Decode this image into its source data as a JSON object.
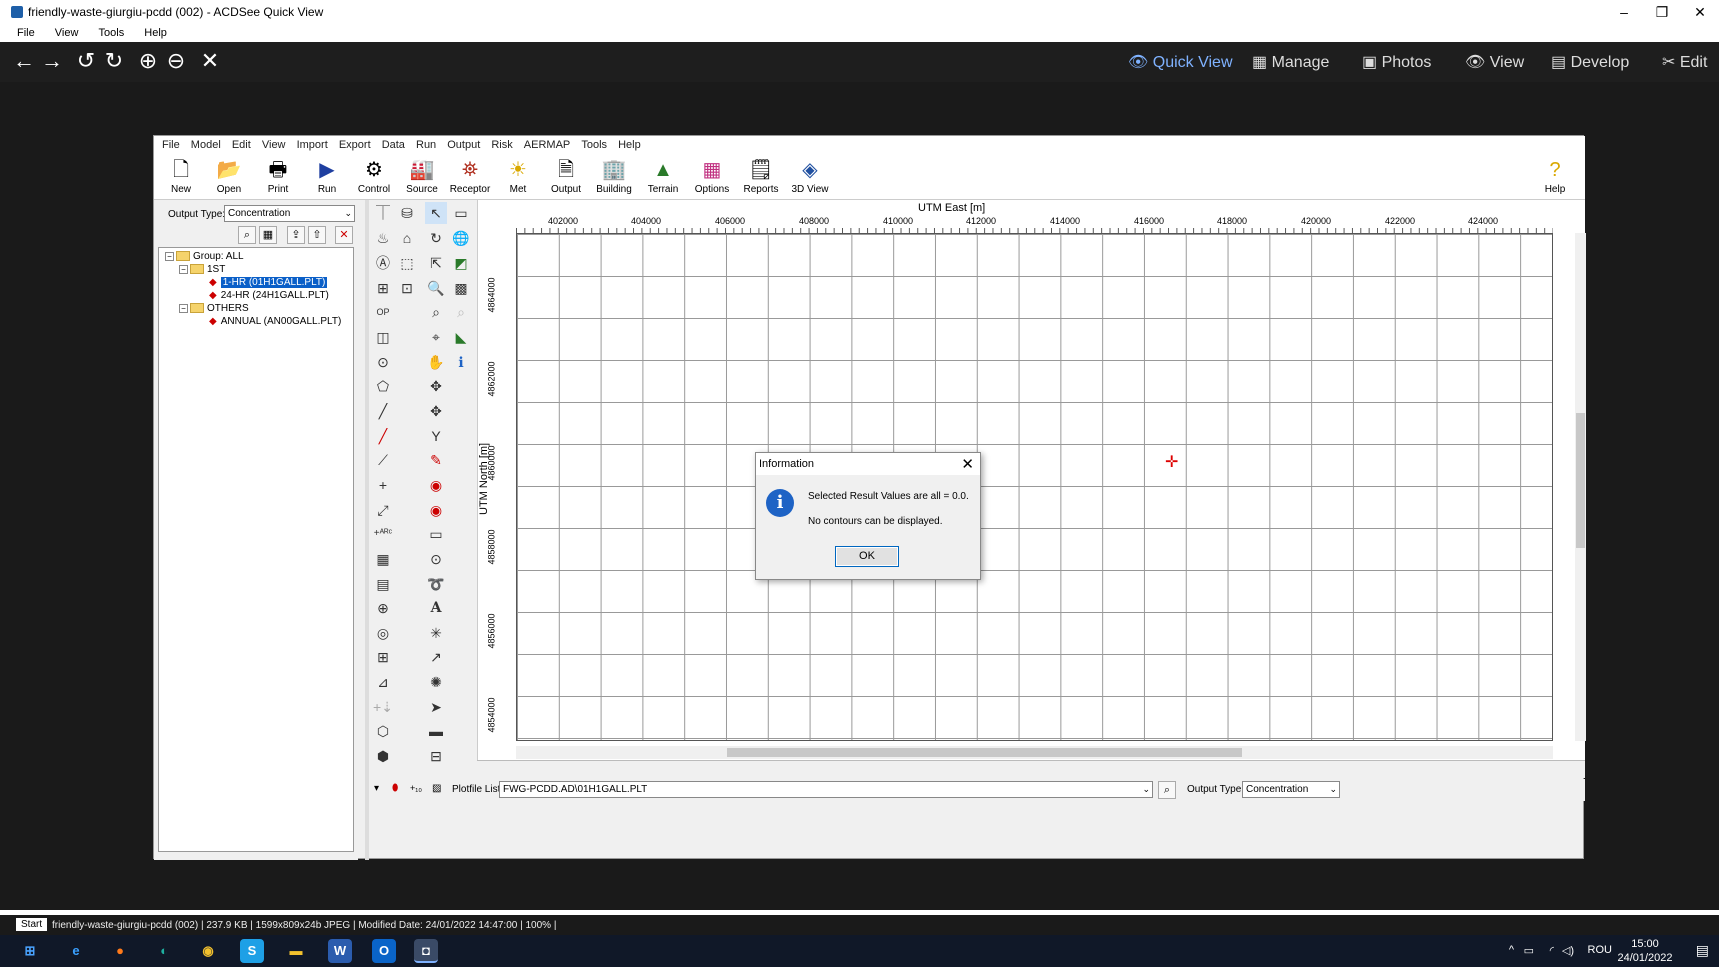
{
  "window": {
    "title": "friendly-waste-giurgiu-pcdd (002) - ACDSee Quick View"
  },
  "acd_menu": [
    "File",
    "View",
    "Tools",
    "Help"
  ],
  "acd_modes": [
    {
      "label": "Quick View",
      "icon": "eye-slash-icon"
    },
    {
      "label": "Manage",
      "icon": "grid-icon"
    },
    {
      "label": "Photos",
      "icon": "photos-icon"
    },
    {
      "label": "View",
      "icon": "eye-icon"
    },
    {
      "label": "Develop",
      "icon": "develop-icon"
    },
    {
      "label": "Edit",
      "icon": "edit-icon"
    }
  ],
  "app": {
    "menu": [
      "File",
      "Model",
      "Edit",
      "View",
      "Import",
      "Export",
      "Data",
      "Run",
      "Output",
      "Risk",
      "AERMAP",
      "Tools",
      "Help"
    ],
    "toolbar": [
      "New",
      "Open",
      "Print",
      "Run",
      "Control",
      "Source",
      "Receptor",
      "Met",
      "Output",
      "Building",
      "Terrain",
      "Options",
      "Reports",
      "3D View"
    ],
    "help_label": "Help",
    "output_type_label": "Output Type:",
    "output_type_value": "Concentration",
    "tree": {
      "group": "Group: ALL",
      "first": "1ST",
      "item1": "1-HR (01H1GALL.PLT)",
      "item2": "24-HR (24H1GALL.PLT)",
      "others": "OTHERS",
      "item3": "ANNUAL (AN00GALL.PLT)"
    },
    "map": {
      "x_title": "UTM East [m]",
      "y_title": "UTM North [m]",
      "x_ticks": [
        "402000",
        "404000",
        "406000",
        "408000",
        "410000",
        "412000",
        "414000",
        "416000",
        "418000",
        "420000",
        "422000",
        "424000"
      ],
      "y_ticks": [
        "4864000",
        "4862000",
        "4860000",
        "4858000",
        "4856000",
        "4854000"
      ]
    },
    "bottom": {
      "plotfile_label": "Plotfile List:",
      "plotfile_value": "FWG-PCDD.AD\\01H1GALL.PLT",
      "output_type_label": "Output Type:",
      "output_type_value": "Concentration"
    },
    "dialog": {
      "title": "Information",
      "line1": "Selected Result Values are all = 0.0.",
      "line2": "No contours can be displayed.",
      "ok": "OK"
    }
  },
  "status": {
    "start": "Start",
    "file": "friendly-waste-giurgiu-pcdd (002)",
    "size": "237.9 KB",
    "dims": "1599x809x24b JPEG",
    "modified": "Modified Date: 24/01/2022 14:47:00",
    "zoom": "100%"
  },
  "taskbar": {
    "lang": "ROU",
    "time": "15:00",
    "date": "24/01/2022"
  }
}
